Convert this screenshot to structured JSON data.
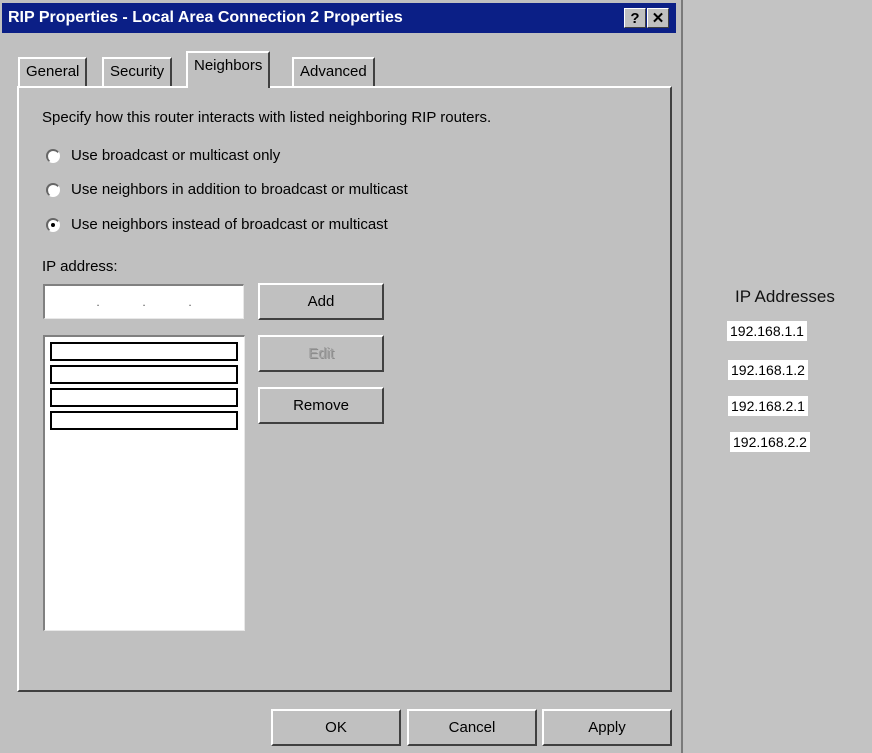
{
  "dialog": {
    "title": "RIP Properties - Local Area Connection 2 Properties",
    "help_label": "?",
    "close_label": "✕",
    "tabs": [
      {
        "label": "General"
      },
      {
        "label": "Security"
      },
      {
        "label": "Neighbors"
      },
      {
        "label": "Advanced"
      }
    ],
    "active_tab": "Neighbors",
    "description": "Specify how this router interacts with listed neighboring RIP routers.",
    "radios": [
      {
        "label": "Use broadcast or multicast only",
        "checked": false
      },
      {
        "label": "Use neighbors in addition to broadcast or multicast",
        "checked": false
      },
      {
        "label": "Use neighbors instead of broadcast or multicast",
        "checked": true
      }
    ],
    "ip_label": "IP address:",
    "ip_value": ". . .",
    "add_label": "Add",
    "edit_label": "Edit",
    "remove_label": "Remove",
    "ok_label": "OK",
    "cancel_label": "Cancel",
    "apply_label": "Apply"
  },
  "side_panel": {
    "title": "IP Addresses",
    "addresses": [
      "192.168.1.1",
      "192.168.1.2",
      "192.168.2.1",
      "192.168.2.2"
    ]
  }
}
